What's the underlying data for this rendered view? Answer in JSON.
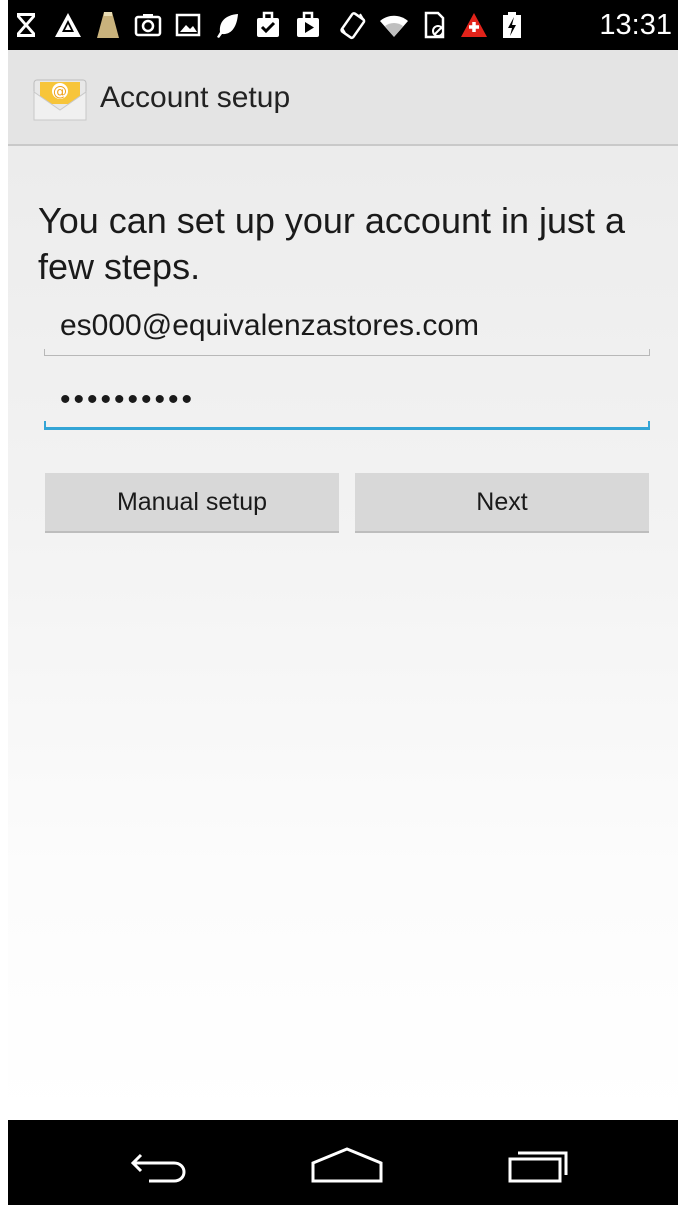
{
  "status_bar": {
    "time": "13:31",
    "icons": [
      "notification-x-icon",
      "warning-triangle-icon",
      "lamp-icon",
      "camera-icon",
      "image-icon",
      "leaf-icon",
      "clipboard-check-icon",
      "play-store-icon",
      "vibrate-icon",
      "wifi-icon",
      "sim-card-icon",
      "alert-icon",
      "battery-charging-icon"
    ],
    "alert_color": "#e2231a"
  },
  "action_bar": {
    "title": "Account setup",
    "icon": "email-app-icon"
  },
  "main": {
    "instructions": "You can set up your account in just a few steps.",
    "email_value": "es000@equivalenzastores.com",
    "password_value": "••••••••••",
    "manual_setup_label": "Manual setup",
    "next_label": "Next",
    "focus_color": "#33a5d6"
  },
  "nav_bar": {
    "buttons": [
      "back-icon",
      "home-icon",
      "recents-icon"
    ]
  }
}
